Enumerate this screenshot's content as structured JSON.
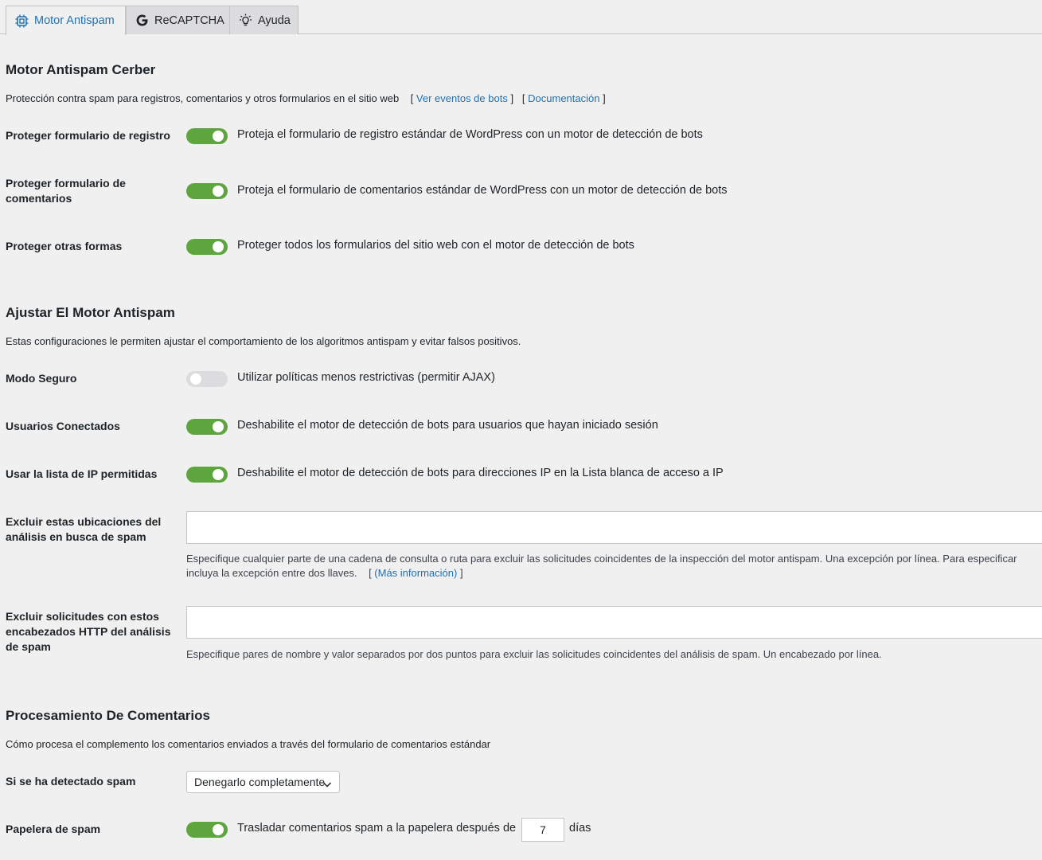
{
  "tabs": [
    {
      "label": "Motor Antispam",
      "icon": "chip-icon",
      "active": true
    },
    {
      "label": "ReCAPTCHA",
      "icon": "google-icon"
    },
    {
      "label": "Ayuda",
      "icon": "lightbulb-icon"
    }
  ],
  "colors": {
    "accent": "#2271b1",
    "toggle_on": "#5fa53f",
    "toggle_off": "#dcdcde"
  },
  "section1": {
    "title": "Motor Antispam Cerber",
    "desc": "Protección contra spam para registros, comentarios y otros formularios en el sitio web",
    "link1": "Ver eventos de bots",
    "link2": "Documentación",
    "rows": [
      {
        "label": "Proteger formulario de registro",
        "on": true,
        "text": "Proteja el formulario de registro estándar de WordPress con un motor de detección de bots"
      },
      {
        "label": "Proteger formulario de comentarios",
        "on": true,
        "text": "Proteja el formulario de comentarios estándar de WordPress con un motor de detección de bots"
      },
      {
        "label": "Proteger otras formas",
        "on": true,
        "text": "Proteger todos los formularios del sitio web con el motor de detección de bots"
      }
    ]
  },
  "section2": {
    "title": "Ajustar El Motor Antispam",
    "desc": "Estas configuraciones le permiten ajustar el comportamiento de los algoritmos antispam y evitar falsos positivos.",
    "rows": [
      {
        "label": "Modo Seguro",
        "on": false,
        "text": "Utilizar políticas menos restrictivas (permitir AJAX)"
      },
      {
        "label": "Usuarios Conectados",
        "on": true,
        "text": "Deshabilite el motor de detección de bots para usuarios que hayan iniciado sesión"
      },
      {
        "label": "Usar la lista de IP permitidas",
        "on": true,
        "text": "Deshabilite el motor de detección de bots para direcciones IP en la Lista blanca de acceso a IP"
      }
    ],
    "exclude_locations": {
      "label": "Excluir estas ubicaciones del análisis en busca de spam",
      "value": "",
      "help_line1": "Especifique cualquier parte de una cadena de consulta o ruta para excluir las solicitudes coincidentes de la inspección del motor antispam. Una excepción por línea. Para especificar",
      "help_line2": "incluya la excepción entre dos llaves.",
      "help_link": "(Más información)"
    },
    "exclude_headers": {
      "label": "Excluir solicitudes con estos encabezados HTTP del análisis de spam",
      "value": "",
      "help": "Especifique pares de nombre y valor separados por dos puntos para excluir las solicitudes coincidentes del análisis de spam. Un encabezado por línea."
    }
  },
  "section3": {
    "title": "Procesamiento De Comentarios",
    "desc": "Cómo procesa el complemento los comentarios enviados a través del formulario de comentarios estándar",
    "spam_detected": {
      "label": "Si se ha detectado spam",
      "selected": "Denegarlo completamente"
    },
    "trash": {
      "label": "Papelera de spam",
      "on": true,
      "text_before": "Trasladar comentarios spam a la papelera después de",
      "days": "7",
      "text_after": "días"
    }
  }
}
